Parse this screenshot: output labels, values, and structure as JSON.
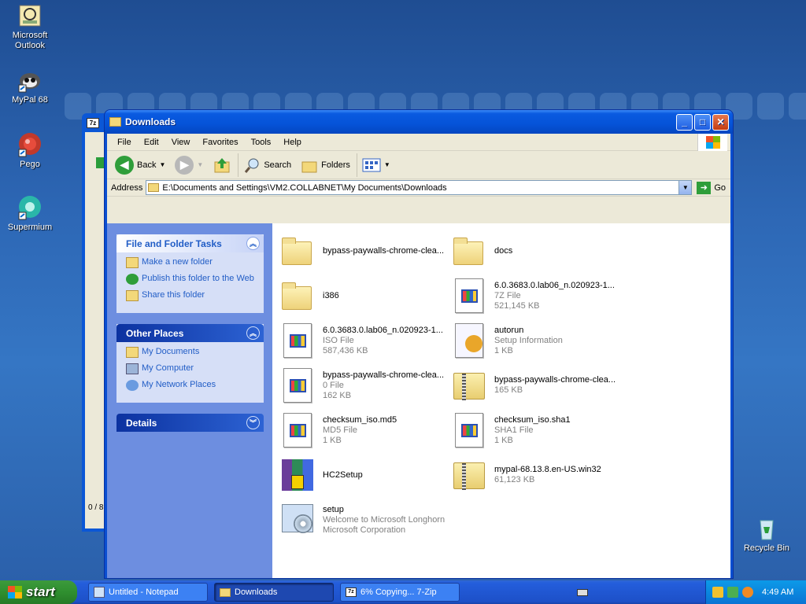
{
  "desktop": {
    "icons": [
      {
        "label": "Microsoft Outlook"
      },
      {
        "label": "MyPal 68"
      },
      {
        "label": "Pego"
      },
      {
        "label": "Supermium"
      },
      {
        "label": "Recycle Bin"
      }
    ]
  },
  "window": {
    "title": "Downloads",
    "menu": [
      "File",
      "Edit",
      "View",
      "Favorites",
      "Tools",
      "Help"
    ],
    "toolbar": {
      "back": "Back",
      "search": "Search",
      "folders": "Folders"
    },
    "address": {
      "label": "Address",
      "path": "E:\\Documents and Settings\\VM2.COLLABNET\\My Documents\\Downloads",
      "go": "Go"
    }
  },
  "tasks": {
    "file_folder": {
      "title": "File and Folder Tasks",
      "items": [
        "Make a new folder",
        "Publish this folder to the Web",
        "Share this folder"
      ]
    },
    "other_places": {
      "title": "Other Places",
      "items": [
        "My Documents",
        "My Computer",
        "My Network Places"
      ]
    },
    "details": {
      "title": "Details"
    }
  },
  "files": [
    {
      "name": "bypass-paywalls-chrome-clea...",
      "type": "",
      "size": "",
      "icon": "folder"
    },
    {
      "name": "docs",
      "type": "",
      "size": "",
      "icon": "folder"
    },
    {
      "name": "i386",
      "type": "",
      "size": "",
      "icon": "folder"
    },
    {
      "name": "6.0.3683.0.lab06_n.020923-1...",
      "type": "7Z File",
      "size": "521,145 KB",
      "icon": "doc"
    },
    {
      "name": "6.0.3683.0.lab06_n.020923-1...",
      "type": "ISO File",
      "size": "587,436 KB",
      "icon": "doc"
    },
    {
      "name": "autorun",
      "type": "Setup Information",
      "size": "1 KB",
      "icon": "setup-info"
    },
    {
      "name": "bypass-paywalls-chrome-clea...",
      "type": "0 File",
      "size": "162 KB",
      "icon": "doc"
    },
    {
      "name": "bypass-paywalls-chrome-clea...",
      "type": "165 KB",
      "size": "",
      "icon": "zip"
    },
    {
      "name": "checksum_iso.md5",
      "type": "MD5 File",
      "size": "1 KB",
      "icon": "doc"
    },
    {
      "name": "checksum_iso.sha1",
      "type": "SHA1 File",
      "size": "1 KB",
      "icon": "doc"
    },
    {
      "name": "HC2Setup",
      "type": "",
      "size": "",
      "icon": "installer"
    },
    {
      "name": "mypal-68.13.8.en-US.win32",
      "type": "61,123 KB",
      "size": "",
      "icon": "zip"
    },
    {
      "name": "setup",
      "type": "Welcome to Microsoft Longhorn",
      "size": "Microsoft Corporation",
      "icon": "setup"
    }
  ],
  "back_window": {
    "status": "0 / 8"
  },
  "taskbar": {
    "start": "start",
    "tasks": [
      "Untitled - Notepad",
      "Downloads",
      "6% Copying... 7-Zip"
    ],
    "clock": "4:49 AM"
  }
}
